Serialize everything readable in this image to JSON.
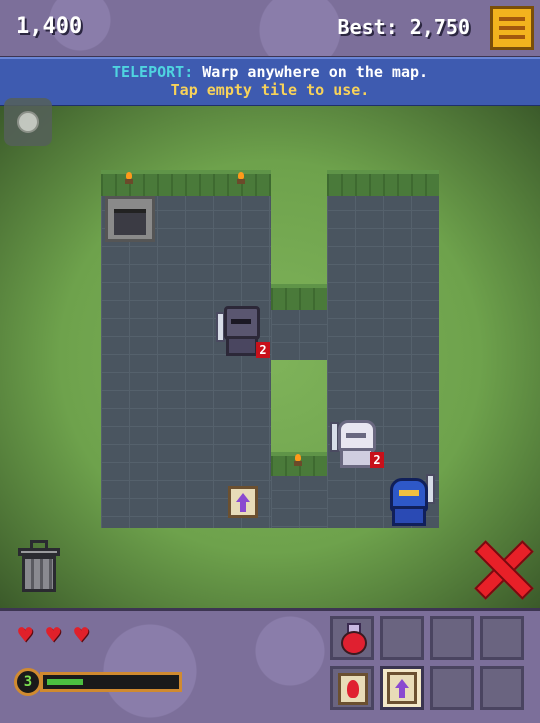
{
  "header": {
    "score": "1,400",
    "best": "Best: 2,750",
    "menu_icon": "hamburger-menu-icon"
  },
  "info": {
    "keyword": "TELEPORT:",
    "line1_rest": " Warp anywhere on the map.",
    "line2": "Tap empty tile to use."
  },
  "enemies": [
    {
      "type": "dark-knight",
      "level": "2"
    },
    {
      "type": "skeleton-knight",
      "level": "2"
    }
  ],
  "player": {
    "hearts": 3,
    "level": "3",
    "xp_fraction": 0.28
  },
  "inventory": {
    "top_row": [
      "health-potion",
      "empty",
      "empty",
      "empty"
    ],
    "bottom_row": [
      "fire-scroll",
      "teleport-scroll",
      "empty",
      "empty"
    ],
    "selected": "teleport-scroll"
  },
  "colors": {
    "accent_yellow": "#f3b31e",
    "info_bar": "#3e5bb0",
    "keyword": "#4fd4e0",
    "hint": "#f7d25a",
    "heart": "#e0202a",
    "xp": "#4cc040"
  }
}
